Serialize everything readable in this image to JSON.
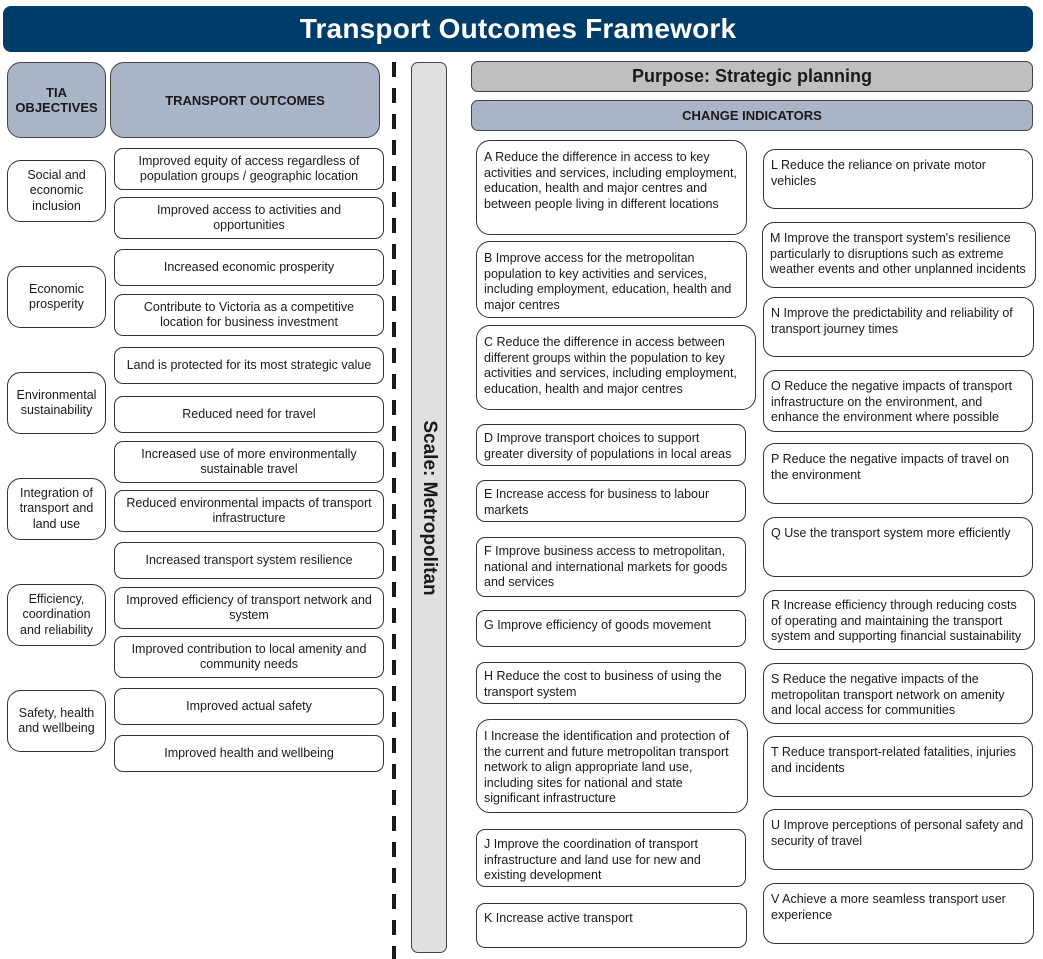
{
  "title": "Transport Outcomes Framework",
  "headers": {
    "tia_objectives": "TIA OBJECTIVES",
    "transport_outcomes": "TRANSPORT OUTCOMES",
    "purpose": "Purpose: Strategic planning",
    "change_indicators": "CHANGE INDICATORS",
    "scale": "Scale: Metropolitan"
  },
  "objectives": [
    "Social and economic inclusion",
    "Economic prosperity",
    "Environmental sustainability",
    "Integration of transport and land use",
    "Efficiency, coordination and reliability",
    "Safety, health and wellbeing"
  ],
  "outcomes": [
    "Improved equity of access regardless of population groups / geographic location",
    "Improved access to activities and opportunities",
    "Increased economic prosperity",
    "Contribute to Victoria as a competitive location for business investment",
    "Land is protected for its most strategic value",
    "Reduced need for travel",
    "Increased use of more environmentally sustainable travel",
    "Reduced environmental impacts of transport infrastructure",
    "Increased transport system resilience",
    "Improved efficiency of transport network and system",
    "Improved contribution to local amenity and community needs",
    "Improved actual safety",
    "Improved health and wellbeing"
  ],
  "indicators_left": [
    "A Reduce the difference in access to key activities and services, including employment, education, health and major centres and between people living in different locations",
    "B Improve access for the metropolitan population to key activities and services, including employment, education, health and major centres",
    "C Reduce the difference in access between different groups within the population to key activities and services, including employment, education, health and major centres",
    "D Improve transport choices to support greater diversity of populations in local areas",
    "E Increase access for business to labour markets",
    "F Improve business access to metropolitan, national and international markets for goods and services",
    "G Improve efficiency of goods movement",
    "H Reduce the cost to business of using the transport system",
    "I Increase the identification and protection of the current and future metropolitan transport network to align appropriate land use, including sites for national and state significant infrastructure",
    "J Improve the coordination of transport infrastructure and land use for new and existing development",
    "K Increase active transport"
  ],
  "indicators_right": [
    "L Reduce the reliance on private motor vehicles",
    "M Improve the transport system's resilience particularly to disruptions such as extreme weather events and other unplanned incidents",
    "N Improve the predictability and reliability of transport journey times",
    "O Reduce the negative impacts of transport infrastructure on the environment, and enhance the environment where possible",
    "P Reduce the negative impacts of travel on the environment",
    "Q Use the transport system more efficiently",
    "R Increase efficiency through reducing costs of operating and maintaining the transport system and supporting financial sustainability",
    "S Reduce the negative impacts of the metropolitan transport network on amenity and local access for communities",
    "T Reduce transport-related fatalities, injuries and incidents",
    "U Improve perceptions of personal safety and security of travel",
    "V Achieve a more seamless transport user experience"
  ],
  "colors": {
    "title_bg": "#003c69",
    "header_bg": "#a9b4c7",
    "purpose_bg": "#bfbfbf",
    "scale_bg": "#e0e0e0"
  }
}
